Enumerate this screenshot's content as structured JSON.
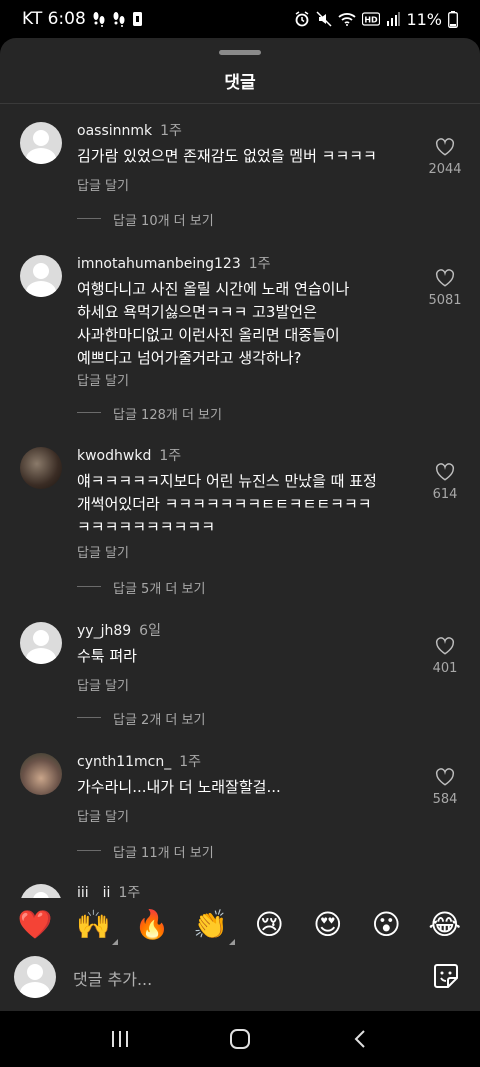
{
  "status": {
    "carrier_time": "KT 6:08",
    "battery": "11%"
  },
  "sheet": {
    "title": "댓글"
  },
  "comments": [
    {
      "username": "oassinnmk",
      "time": "1주",
      "text": "김가람 있었으면 존재감도 없었을 멤버 ㅋㅋㅋㅋ",
      "reply_label": "답글 달기",
      "more_replies": "답글 10개 더 보기",
      "likes": "2044"
    },
    {
      "username": "imnotahumanbeing123",
      "time": "1주",
      "text_lines": [
        "여행다니고 사진 올릴 시간에 노래 연습이나",
        "하세요 욕먹기싫으면ㅋㅋㅋ 고3발언은",
        "사과한마디없고 이런사진 올리면 대중들이",
        "예쁘다고 넘어가줄거라고 생각하나?"
      ],
      "reply_label": "답글 달기",
      "more_replies": "답글 128개 더 보기",
      "likes": "5081"
    },
    {
      "username": "kwodhwkd",
      "time": "1주",
      "text_lines": [
        "얘ㅋㅋㅋㅋㅋ지보다 어린 뉴진스 만났을 때 표정",
        "개썩어있더라 ㅋㅋㅋㅋㅋㅋㅋㅌㅌㅋㅌㅌㅋㅋㅋ",
        "ㅋㅋㅋㅋㅋㅋㅋㅋㅋㅋ"
      ],
      "reply_label": "답글 달기",
      "more_replies": "답글 5개 더 보기",
      "likes": "614"
    },
    {
      "username": "yy_jh89",
      "time": "6일",
      "text": "수툭 펴라",
      "reply_label": "답글 달기",
      "more_replies": "답글 2개 더 보기",
      "likes": "401"
    },
    {
      "username": "cynth11mcn_",
      "time": "1주",
      "text": "가수라니...내가 더 노래잘할걸...",
      "reply_label": "답글 달기",
      "more_replies": "답글 11개 더 보기",
      "likes": "584"
    }
  ],
  "partial_comment": {
    "username": "iii__ii",
    "time": "1주"
  },
  "emoji_bar": [
    "❤️",
    "🙌",
    "🔥",
    "👏",
    "😢",
    "😍",
    "😮",
    "😂"
  ],
  "input": {
    "placeholder": "댓글 추가..."
  }
}
